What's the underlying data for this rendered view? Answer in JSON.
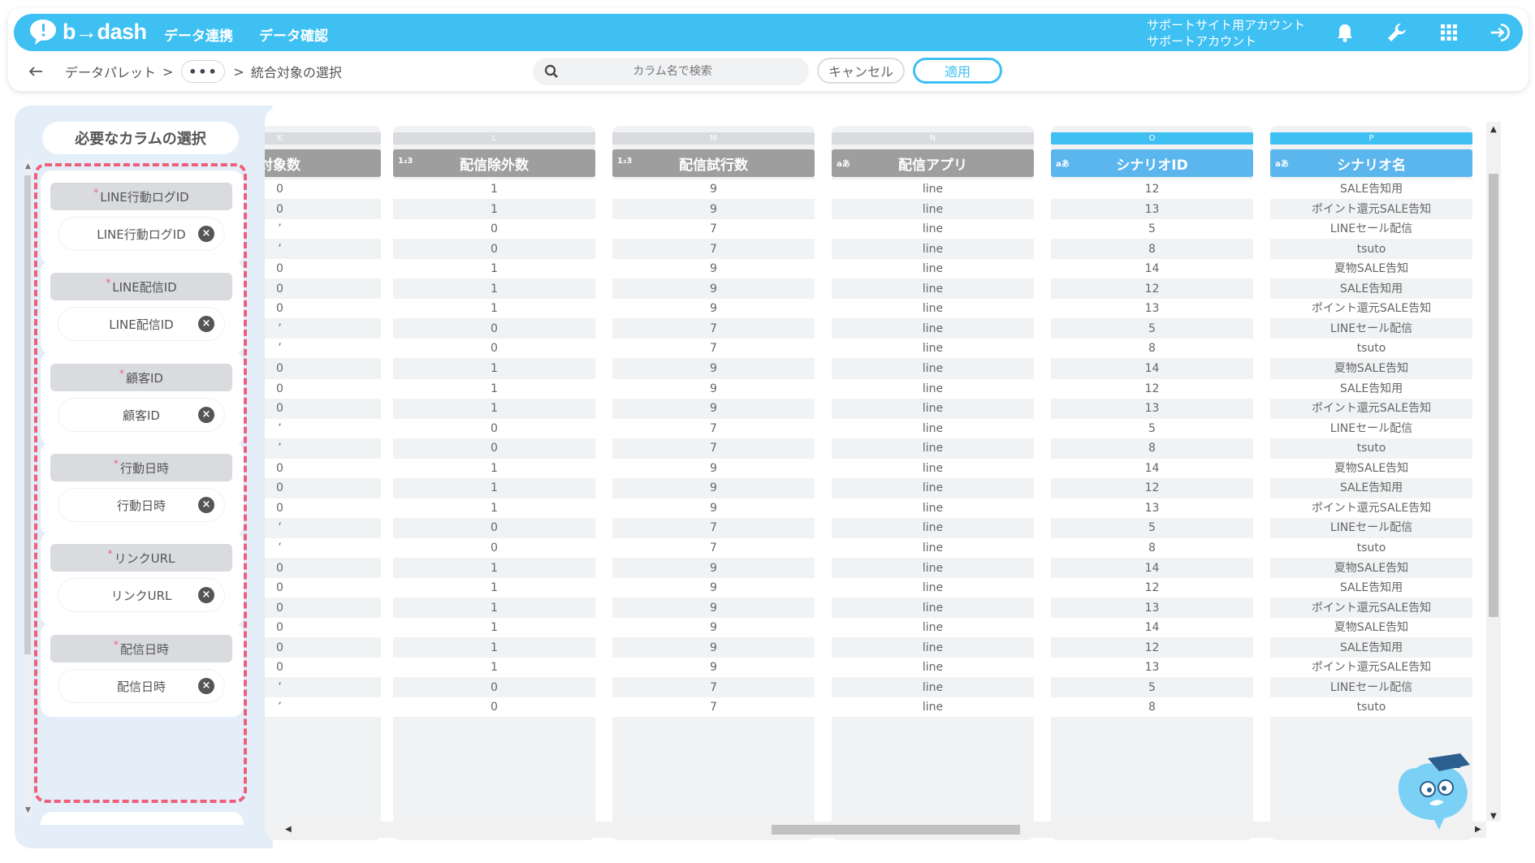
{
  "header": {
    "logo_text": "b→dash",
    "nav": [
      "データ連携",
      "データ確認"
    ],
    "account_line1": "サポートサイト用アカウント",
    "account_line2": "サポートアカウント",
    "icons": [
      "bell-icon",
      "wrench-icon",
      "grid-icon",
      "logout-icon"
    ],
    "brand_color": "#3ec0f3"
  },
  "subbar": {
    "crumb1": "データパレット",
    "sep": ">",
    "ellipsis": "•••",
    "crumb2": "統合対象の選択",
    "search_placeholder": "カラム名で検索",
    "cancel": "キャンセル",
    "apply": "適用"
  },
  "left": {
    "title": "必要なカラムの選択",
    "required_mark": "*",
    "items": [
      {
        "label": "LINE行動ログID",
        "value": "LINE行動ログID"
      },
      {
        "label": "LINE配信ID",
        "value": "LINE配信ID"
      },
      {
        "label": "顧客ID",
        "value": "顧客ID"
      },
      {
        "label": "行動日時",
        "value": "行動日時"
      },
      {
        "label": "リンクURL",
        "value": "リンクURL"
      },
      {
        "label": "配信日時",
        "value": "配信日時"
      }
    ],
    "accent_color": "#ef5f7a"
  },
  "grid": {
    "columns": [
      {
        "letter": "K",
        "type": "",
        "header": "対象数",
        "values": [
          "0",
          "0",
          "’",
          "’",
          "0",
          "0",
          "0",
          "’",
          "’",
          "0",
          "0",
          "0",
          "’",
          "’",
          "0",
          "0",
          "0",
          "’",
          "’",
          "0",
          "0",
          "0",
          "0",
          "0",
          "0",
          "’",
          "’"
        ]
      },
      {
        "letter": "L",
        "type": "1₂3",
        "header": "配信除外数",
        "values": [
          "1",
          "1",
          "0",
          "0",
          "1",
          "1",
          "1",
          "0",
          "0",
          "1",
          "1",
          "1",
          "0",
          "0",
          "1",
          "1",
          "1",
          "0",
          "0",
          "1",
          "1",
          "1",
          "1",
          "1",
          "1",
          "0",
          "0"
        ]
      },
      {
        "letter": "M",
        "type": "1₂3",
        "header": "配信試行数",
        "values": [
          "9",
          "9",
          "7",
          "7",
          "9",
          "9",
          "9",
          "7",
          "7",
          "9",
          "9",
          "9",
          "7",
          "7",
          "9",
          "9",
          "9",
          "7",
          "7",
          "9",
          "9",
          "9",
          "9",
          "9",
          "9",
          "7",
          "7"
        ]
      },
      {
        "letter": "N",
        "type": "aあ",
        "header": "配信アプリ",
        "values": [
          "line",
          "line",
          "line",
          "line",
          "line",
          "line",
          "line",
          "line",
          "line",
          "line",
          "line",
          "line",
          "line",
          "line",
          "line",
          "line",
          "line",
          "line",
          "line",
          "line",
          "line",
          "line",
          "line",
          "line",
          "line",
          "line",
          "line"
        ]
      },
      {
        "letter": "O",
        "type": "aあ",
        "header": "シナリオID",
        "active": true,
        "values": [
          "12",
          "13",
          "5",
          "8",
          "14",
          "12",
          "13",
          "5",
          "8",
          "14",
          "12",
          "13",
          "5",
          "8",
          "14",
          "12",
          "13",
          "5",
          "8",
          "14",
          "12",
          "13",
          "14",
          "12",
          "13",
          "5",
          "8"
        ]
      },
      {
        "letter": "P",
        "type": "aあ",
        "header": "シナリオ名",
        "active": true,
        "values": [
          "SALE告知用",
          "ポイント還元SALE告知",
          "LINEセール配信",
          "tsuto",
          "夏物SALE告知",
          "SALE告知用",
          "ポイント還元SALE告知",
          "LINEセール配信",
          "tsuto",
          "夏物SALE告知",
          "SALE告知用",
          "ポイント還元SALE告知",
          "LINEセール配信",
          "tsuto",
          "夏物SALE告知",
          "SALE告知用",
          "ポイント還元SALE告知",
          "LINEセール配信",
          "tsuto",
          "夏物SALE告知",
          "SALE告知用",
          "ポイント還元SALE告知",
          "夏物SALE告知",
          "SALE告知用",
          "ポイント還元SALE告知",
          "LINEセール配信",
          "tsuto"
        ]
      }
    ]
  }
}
